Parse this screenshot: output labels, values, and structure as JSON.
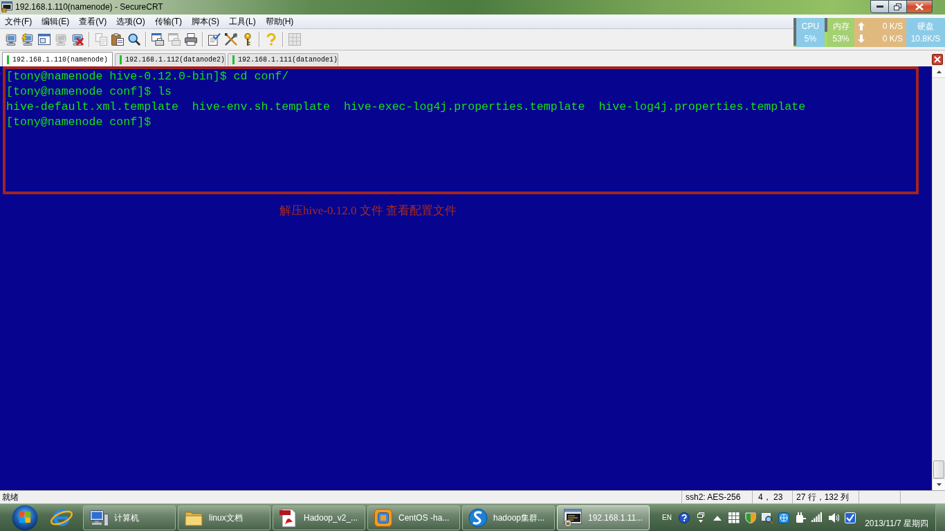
{
  "window": {
    "title": "192.168.1.110(namenode) - SecureCRT"
  },
  "menu": [
    "文件(F)",
    "编辑(E)",
    "查看(V)",
    "选项(O)",
    "传输(T)",
    "脚本(S)",
    "工具(L)",
    "帮助(H)"
  ],
  "toolbar": {
    "groups": [
      [
        {
          "disabled": false
        },
        {
          "disabled": false
        },
        {
          "disabled": false
        },
        {
          "disabled": true
        },
        {
          "disabled": false
        }
      ],
      [
        {
          "disabled": true
        },
        {
          "disabled": false
        },
        {
          "disabled": false
        }
      ],
      [
        {
          "disabled": false
        },
        {
          "disabled": true
        },
        {
          "disabled": false
        }
      ],
      [
        {
          "disabled": false
        },
        {
          "disabled": false
        },
        {
          "disabled": false
        }
      ],
      [
        {
          "disabled": false
        }
      ],
      [
        {
          "disabled": true
        }
      ]
    ]
  },
  "system_monitor": {
    "cpu": {
      "label": "CPU",
      "value": "5%",
      "level": 0.05
    },
    "memory": {
      "label": "内存",
      "value": "53%",
      "level": 0.53
    },
    "network": {
      "upload": "0 K/S",
      "download": "0 K/S"
    },
    "disk": {
      "label": "硬盘",
      "value": "10.8K/S"
    }
  },
  "tabs": [
    {
      "label": "192.168.1.110(namenode)",
      "selected": true
    },
    {
      "label": "192.168.1.112(datanode2)",
      "selected": false
    },
    {
      "label": "192.168.1.111(datanode1)",
      "selected": false
    }
  ],
  "terminal": {
    "lines": [
      "[tony@namenode hive-0.12.0-bin]$ cd conf/",
      "[tony@namenode conf]$ ls",
      "hive-default.xml.template  hive-env.sh.template  hive-exec-log4j.properties.template  hive-log4j.properties.template",
      "[tony@namenode conf]$"
    ],
    "annotation": {
      "caption": "解压hive-0.12.0 文件 查看配置文件"
    }
  },
  "status_bar": {
    "message": "就绪",
    "cells": [
      "ssh2: AES-256",
      "4， 23",
      "27 行，132 列"
    ]
  },
  "taskbar": {
    "buttons": [
      {
        "label": "计算机",
        "selected": false
      },
      {
        "label": "linux文档",
        "selected": false
      },
      {
        "label": "Hadoop_v2_...",
        "selected": false
      },
      {
        "label": "CentOS -ha...",
        "selected": false
      },
      {
        "label": "hadoop集群...",
        "selected": false
      },
      {
        "label": "192.168.1.11...",
        "selected": true
      }
    ],
    "tray": {
      "language": "EN",
      "date": "2013/11/7 星期四"
    }
  }
}
